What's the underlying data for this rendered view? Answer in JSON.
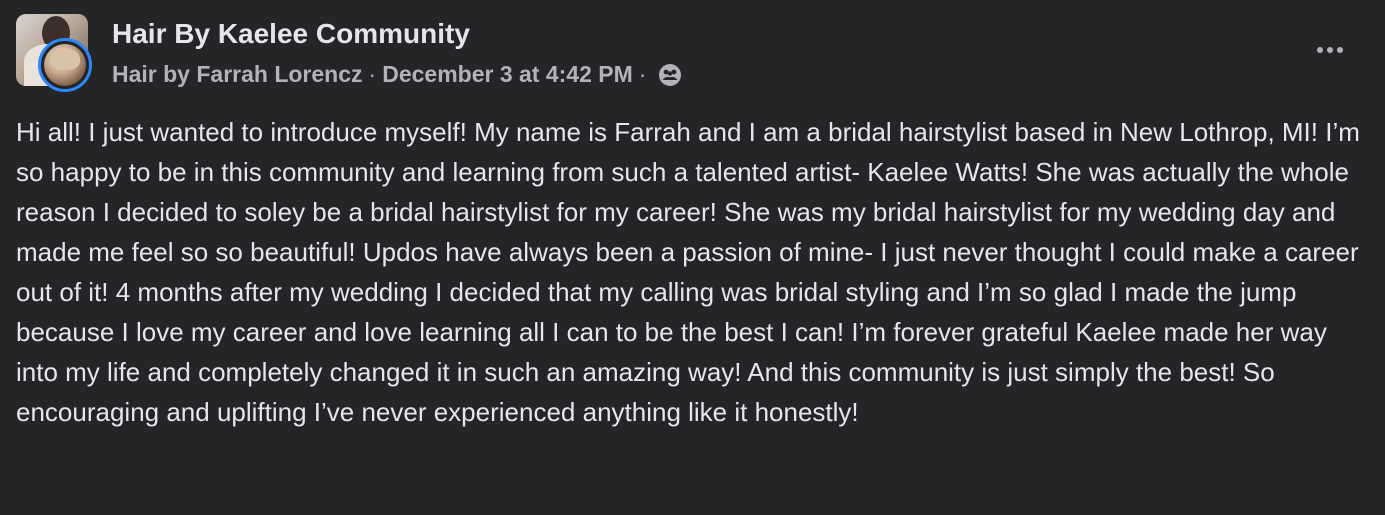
{
  "post": {
    "group_name": "Hair By Kaelee Community",
    "author": "Hair by Farrah Lorencz",
    "separator": "·",
    "timestamp": "December 3 at 4:42 PM",
    "privacy_icon": "group-members-icon",
    "more_icon": "more-options-icon",
    "body": "Hi all! I just wanted to introduce myself! My name is Farrah and I am a bridal hairstylist based in New Lothrop, MI! I’m so happy to be in this community and learning from such a talented artist- Kaelee Watts! She was actually the whole reason I decided to soley be a bridal hairstylist for my career! She was my bridal hairstylist for my wedding day and made me feel so so beautiful! Updos have always been a passion of mine- I just never thought I could make a career out of it! 4 months after my wedding I decided that my calling was bridal styling and I’m so glad I made the jump because I love my career and love learning all I can to be the best I can! I’m forever grateful Kaelee made her way into my life and completely changed it in such an amazing way! And this community is just simply the best! So encouraging and uplifting I’ve never experienced anything like it honestly!"
  },
  "colors": {
    "background": "#242526",
    "primary_text": "#e4e6eb",
    "secondary_text": "#b0b3b8",
    "avatar_ring": "#2d88ff"
  }
}
